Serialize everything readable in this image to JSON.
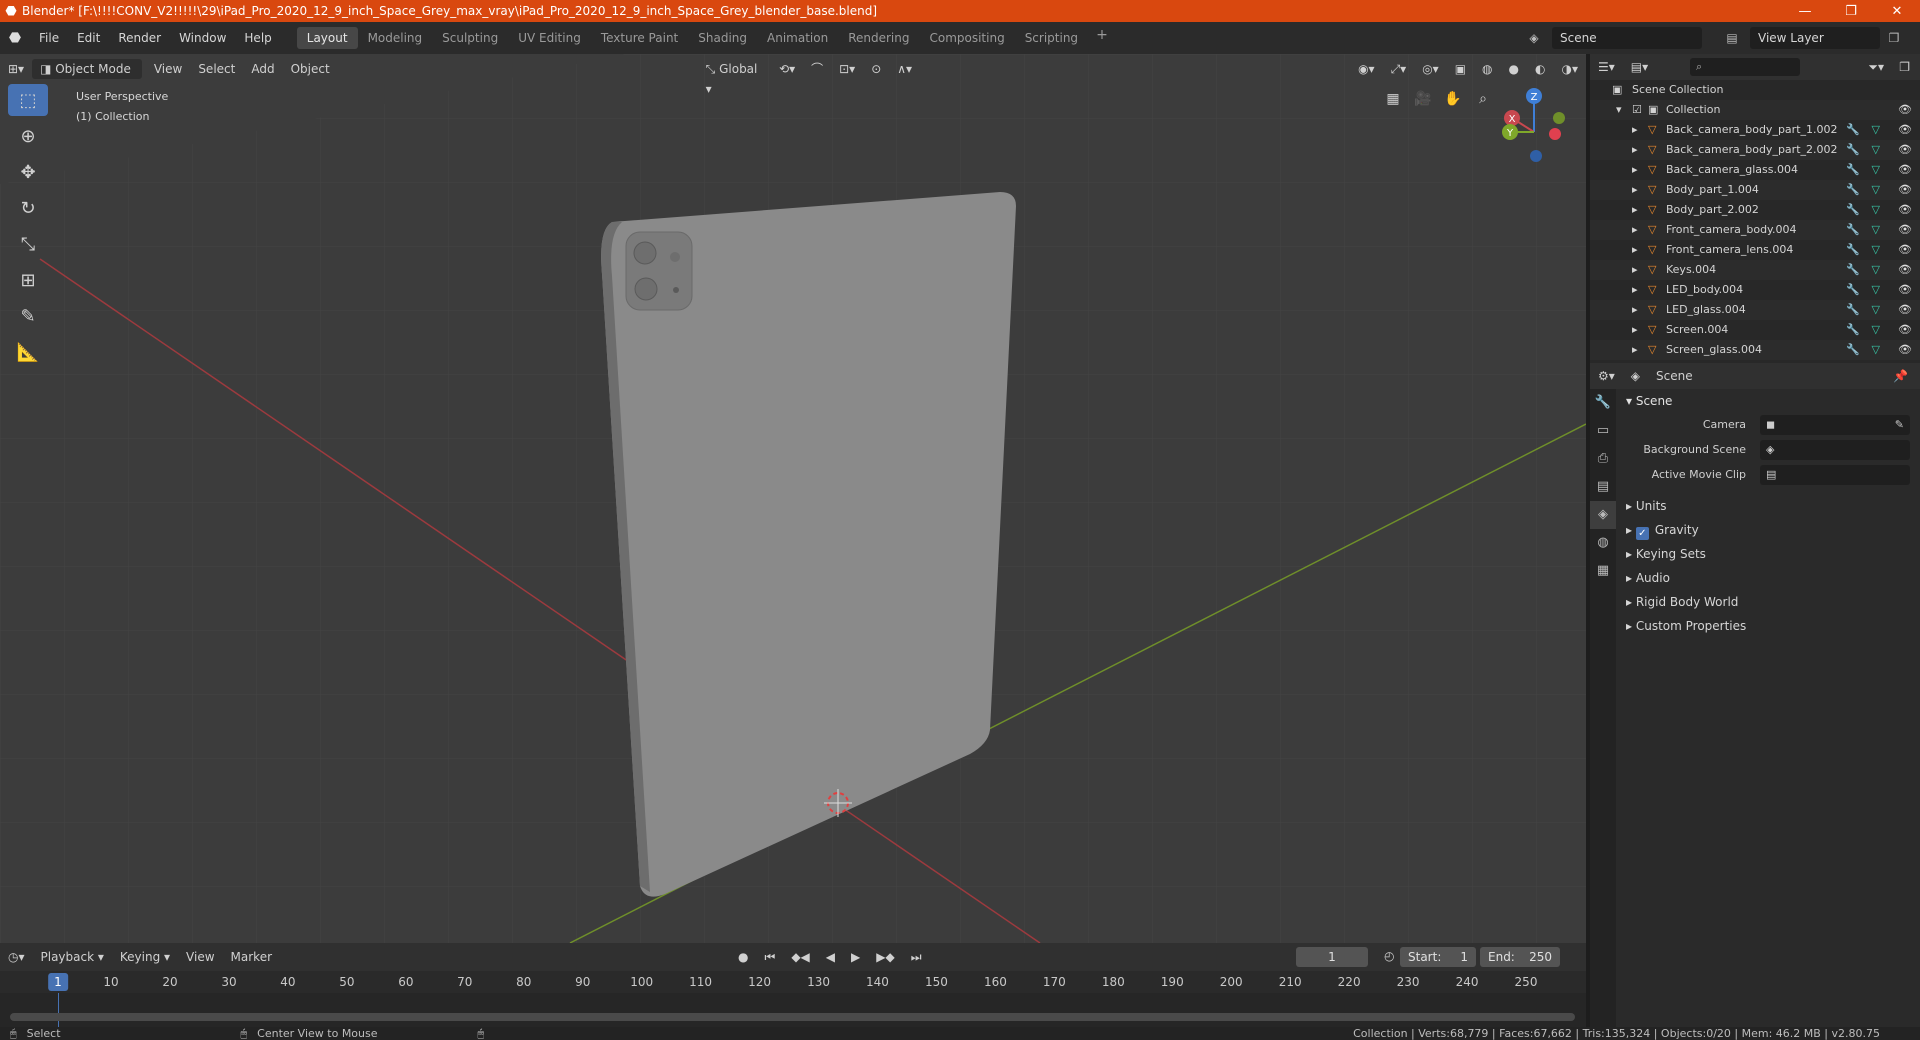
{
  "titlebar": {
    "title": "Blender* [F:\\!!!!CONV_V2!!!!!\\29\\iPad_Pro_2020_12_9_inch_Space_Grey_max_vray\\iPad_Pro_2020_12_9_inch_Space_Grey_blender_base.blend]"
  },
  "menu": [
    "File",
    "Edit",
    "Render",
    "Window",
    "Help"
  ],
  "workspaces": [
    "Layout",
    "Modeling",
    "Sculpting",
    "UV Editing",
    "Texture Paint",
    "Shading",
    "Animation",
    "Rendering",
    "Compositing",
    "Scripting"
  ],
  "active_workspace": "Layout",
  "scene_selector": {
    "value": "Scene"
  },
  "view_layer": {
    "value": "View Layer"
  },
  "viewport": {
    "mode": "Object Mode",
    "menus": [
      "View",
      "Select",
      "Add",
      "Object"
    ],
    "transform_orientation": "Global",
    "perspective_label": "User Perspective",
    "collection_label": "(1) Collection",
    "gizmo": {
      "x": "X",
      "y": "Y",
      "z": "Z"
    }
  },
  "timeline": {
    "menus": [
      "Playback",
      "Keying",
      "View",
      "Marker"
    ],
    "current_frame": "1",
    "start_label": "Start:",
    "start_value": "1",
    "end_label": "End:",
    "end_value": "250",
    "ticks": [
      "1",
      "10",
      "20",
      "30",
      "40",
      "50",
      "60",
      "70",
      "80",
      "90",
      "100",
      "110",
      "120",
      "130",
      "140",
      "150",
      "160",
      "170",
      "180",
      "190",
      "200",
      "210",
      "220",
      "230",
      "240",
      "250"
    ]
  },
  "outliner": {
    "root": "Scene Collection",
    "collection": "Collection",
    "objects": [
      {
        "name": "Back_camera_body_part_1.002"
      },
      {
        "name": "Back_camera_body_part_2.002"
      },
      {
        "name": "Back_camera_glass.004"
      },
      {
        "name": "Body_part_1.004"
      },
      {
        "name": "Body_part_2.002"
      },
      {
        "name": "Front_camera_body.004"
      },
      {
        "name": "Front_camera_lens.004"
      },
      {
        "name": "Keys.004"
      },
      {
        "name": "LED_body.004"
      },
      {
        "name": "LED_glass.004"
      },
      {
        "name": "Screen.004"
      },
      {
        "name": "Screen_glass.004"
      }
    ]
  },
  "properties": {
    "header": "Scene",
    "panel": "Scene",
    "fields": [
      {
        "label": "Camera"
      },
      {
        "label": "Background Scene"
      },
      {
        "label": "Active Movie Clip"
      }
    ],
    "subpanels": [
      "Units",
      "Gravity",
      "Keying Sets",
      "Audio",
      "Rigid Body World",
      "Custom Properties"
    ]
  },
  "statusbar": {
    "left": "Select",
    "middle": "Center View to Mouse",
    "right": "Collection | Verts:68,779 | Faces:67,662 | Tris:135,324 | Objects:0/20 | Mem: 46.2 MB | v2.80.75"
  },
  "colors": {
    "titlebar": "#d9480f",
    "accent": "#4772b3",
    "viewport_bg": "#3c3c3c",
    "x_axis": "#c8484f",
    "y_axis": "#7fa82a",
    "z_axis": "#3f7fd6"
  }
}
